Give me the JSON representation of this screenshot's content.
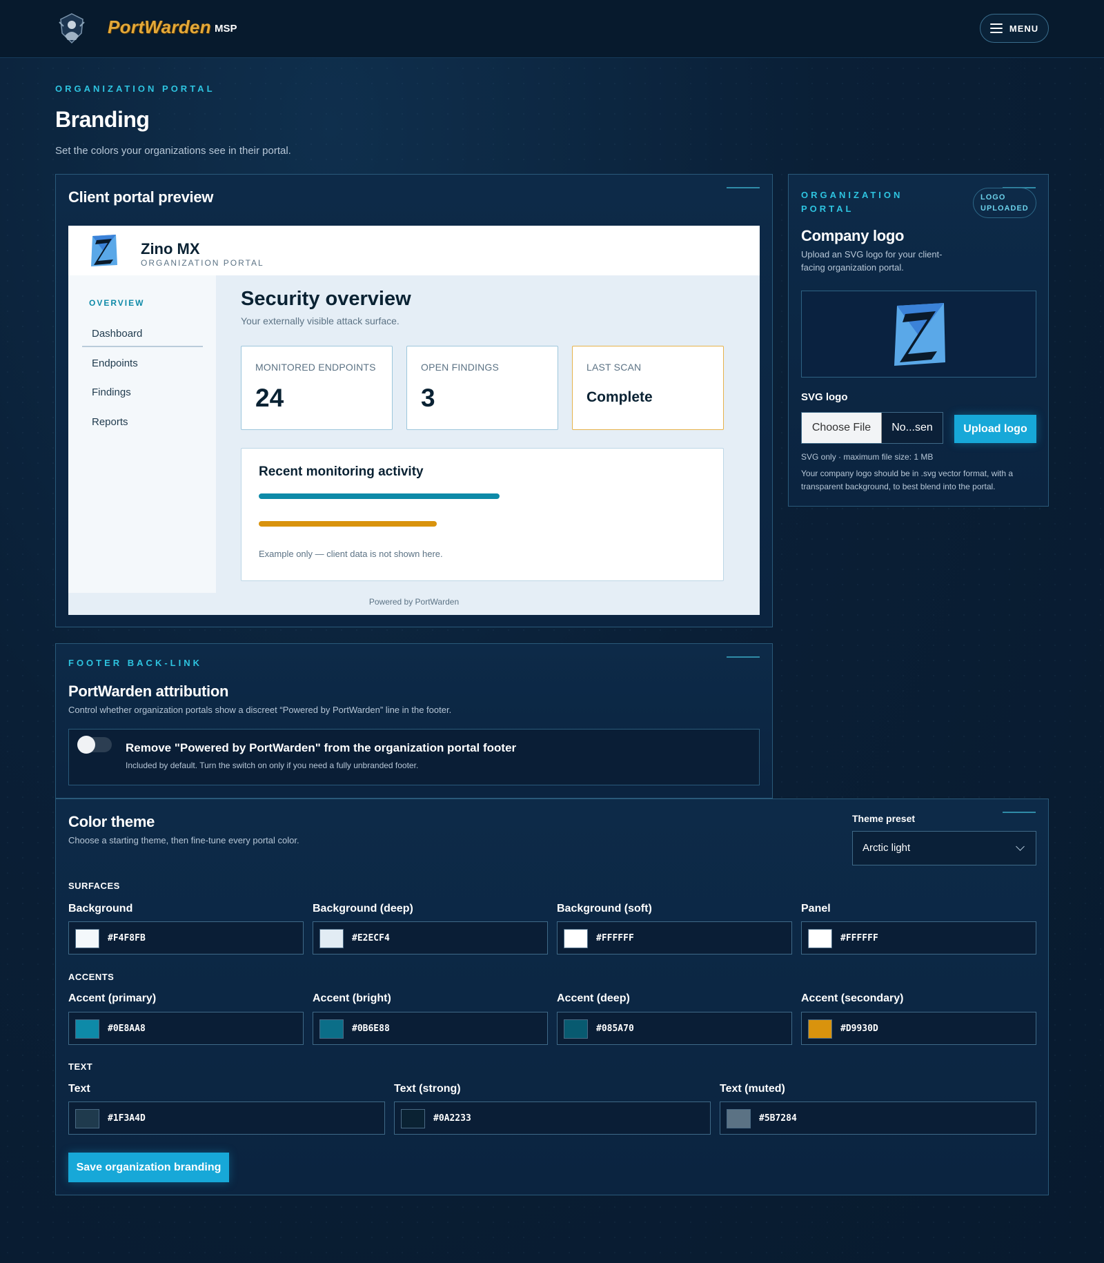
{
  "header": {
    "brand": "PortWarden",
    "brand_suffix": "MSP",
    "menu_label": "MENU"
  },
  "page": {
    "eyebrow": "ORGANIZATION PORTAL",
    "title": "Branding",
    "subtitle": "Set the colors your organizations see in their portal."
  },
  "preview": {
    "title": "Client portal preview",
    "org_name": "Zino MX",
    "org_sub": "ORGANIZATION PORTAL",
    "nav_eyebrow": "OVERVIEW",
    "nav_items": [
      "Dashboard",
      "Endpoints",
      "Findings",
      "Reports"
    ],
    "main_title": "Security overview",
    "main_sub": "Your externally visible attack surface.",
    "stats": [
      {
        "label": "MONITORED ENDPOINTS",
        "value": "24"
      },
      {
        "label": "OPEN FINDINGS",
        "value": "3"
      },
      {
        "label": "LAST SCAN",
        "value": "Complete"
      }
    ],
    "activity_title": "Recent monitoring activity",
    "activity_bars": [
      {
        "fraction": 0.54,
        "color": "#0E8AA8"
      },
      {
        "fraction": 0.4,
        "color": "#D9930D"
      }
    ],
    "activity_note": "Example only — client data is not shown here.",
    "footer": "Powered by PortWarden"
  },
  "logo": {
    "eyebrow": "ORGANIZATION PORTAL",
    "badge": "LOGO UPLOADED",
    "title": "Company logo",
    "subtitle": "Upload an SVG logo for your client-facing organization portal.",
    "svg_label": "SVG logo",
    "choose_file": "Choose File",
    "file_name": "No...sen",
    "upload_button": "Upload logo",
    "hint": "SVG only · maximum file size: 1 MB",
    "description": "Your company logo should be in .svg vector format, with a transparent background, to best blend into the portal."
  },
  "footer_link": {
    "eyebrow": "FOOTER BACK-LINK",
    "title": "PortWarden attribution",
    "subtitle": "Control whether organization portals show a discreet “Powered by PortWarden” line in the footer.",
    "toggle_title": "Remove \"Powered by PortWarden\" from the organization portal footer",
    "toggle_sub": "Included by default. Turn the switch on only if you need a fully unbranded footer.",
    "toggle_on": false
  },
  "theme": {
    "title": "Color theme",
    "subtitle": "Choose a starting theme, then fine-tune every portal color.",
    "preset_label": "Theme preset",
    "preset_value": "Arctic light",
    "groups": [
      {
        "label": "SURFACES",
        "colors": [
          {
            "label": "Background",
            "hex": "#F4F8FB"
          },
          {
            "label": "Background (deep)",
            "hex": "#E2ECF4"
          },
          {
            "label": "Background (soft)",
            "hex": "#FFFFFF"
          },
          {
            "label": "Panel",
            "hex": "#FFFFFF"
          }
        ]
      },
      {
        "label": "ACCENTS",
        "colors": [
          {
            "label": "Accent (primary)",
            "hex": "#0E8AA8"
          },
          {
            "label": "Accent (bright)",
            "hex": "#0B6E88"
          },
          {
            "label": "Accent (deep)",
            "hex": "#085A70"
          },
          {
            "label": "Accent (secondary)",
            "hex": "#D9930D"
          }
        ]
      },
      {
        "label": "TEXT",
        "colors": [
          {
            "label": "Text",
            "hex": "#1F3A4D"
          },
          {
            "label": "Text (strong)",
            "hex": "#0A2233"
          },
          {
            "label": "Text (muted)",
            "hex": "#5B7284"
          }
        ]
      }
    ],
    "save_button": "Save organization branding"
  }
}
